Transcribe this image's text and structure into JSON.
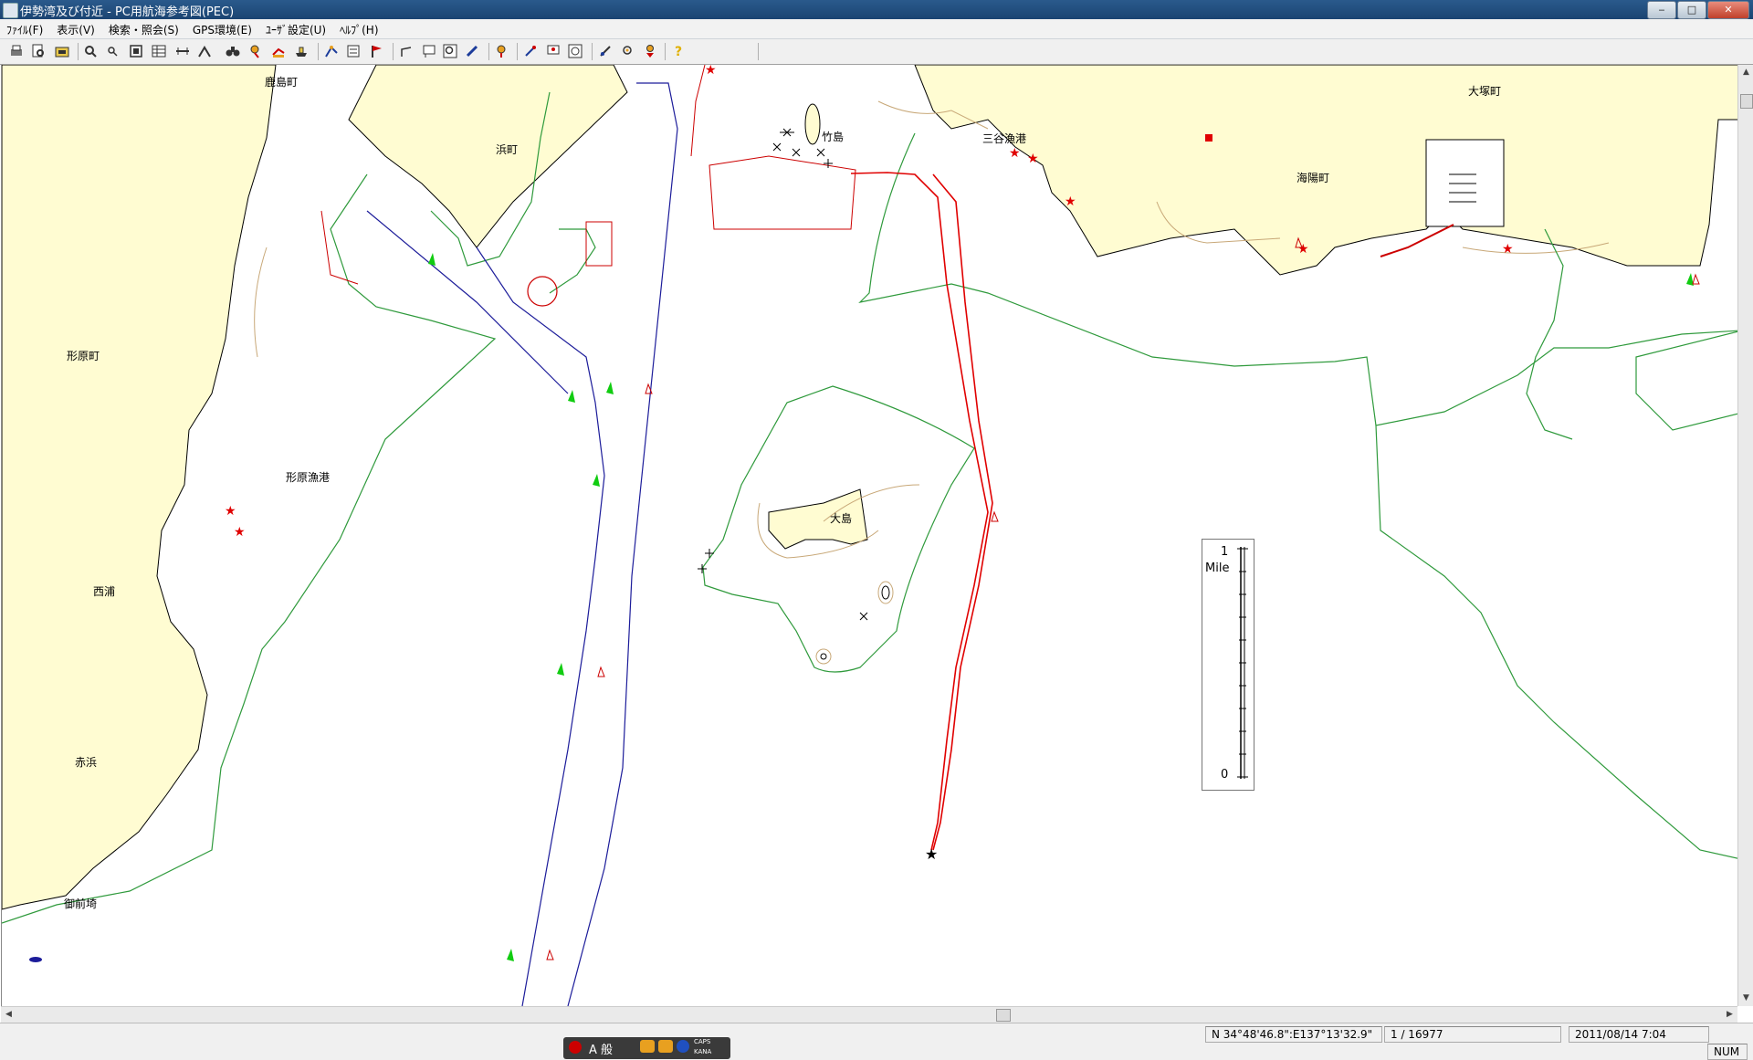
{
  "window": {
    "title": "伊勢湾及び付近 - PC用航海参考図(PEC)",
    "minimize": "‒",
    "maximize": "□",
    "close": "✕"
  },
  "menu": [
    "ﾌｧｲﾙ(F)",
    "表示(V)",
    "検索・照会(S)",
    "GPS環境(E)",
    "ﾕｰｻﾞ設定(U)",
    "ﾍﾙﾌﾟ(H)"
  ],
  "toolbar_icons": [
    "print-icon",
    "print-preview-icon",
    "open-chart-icon",
    "zoom-in-icon",
    "zoom-out-icon",
    "fit-window-icon",
    "grid-icon",
    "ruler-icon",
    "measure-icon",
    "binoculars-icon",
    "marker-icon",
    "route-icon",
    "ship-icon",
    "ship-track-icon",
    "waypoint-icon",
    "flag-icon",
    "line-icon",
    "note-icon",
    "search-icon",
    "pencil-icon",
    "position-icon",
    "pin-icon",
    "mark-icon",
    "find-area-icon",
    "edit-line-icon",
    "query-icon",
    "download-icon",
    "help-icon"
  ],
  "place_names": [
    "鹿島町",
    "浜町",
    "竹島",
    "三谷漁港",
    "大塚町",
    "海陽町",
    "形原町",
    "形原漁港",
    "大島",
    "西浦",
    "赤浜",
    "御前埼"
  ],
  "scale_bar": {
    "unit": "Mile",
    "max": "1",
    "min": "0"
  },
  "status": {
    "position": "N 34°48'46.8\":E137°13'32.9\"",
    "scale": "1 / 16977",
    "datetime": "2011/08/14  7:04",
    "num": "NUM"
  },
  "ime": {
    "mode": "A 般",
    "caps": "CAPS",
    "kana": "KANA"
  },
  "colors": {
    "land": "#fffcd2",
    "depth_contour": "#2f9a3c",
    "channel": "#1c1c9a",
    "track": "#e00000",
    "coast_shoal": "#c8a878",
    "title_bar": "#1e4a78"
  }
}
